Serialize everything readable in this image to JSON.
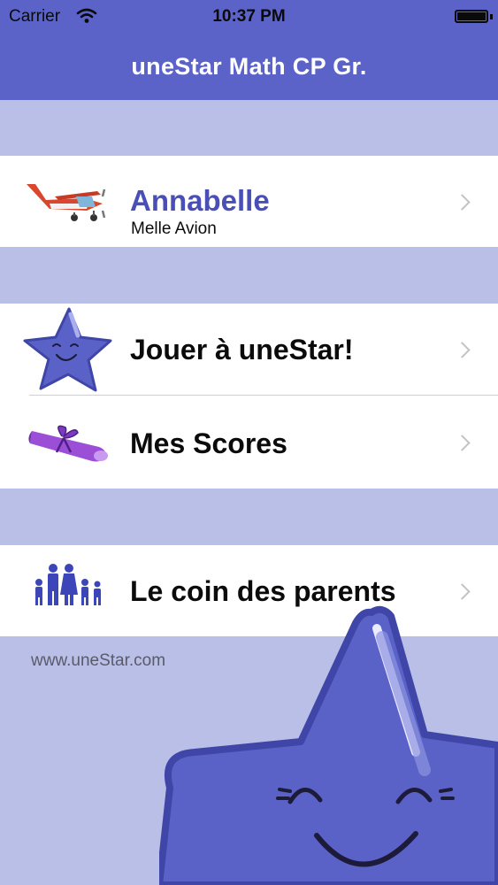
{
  "status_bar": {
    "carrier": "Carrier",
    "time": "10:37 PM"
  },
  "nav": {
    "title": "uneStar Math CP Gr."
  },
  "profile": {
    "name": "Annabelle",
    "subtitle": "Melle Avion"
  },
  "menu": {
    "play": "Jouer à uneStar!",
    "scores": "Mes Scores",
    "parents": "Le coin des parents"
  },
  "footer": {
    "website": "www.uneStar.com"
  },
  "colors": {
    "accent": "#5b63c9",
    "background": "#b9bfe6",
    "name_text": "#4a4fb8",
    "star": "#5a62c8"
  },
  "icons": {
    "profile": "airplane-icon",
    "play": "star-icon",
    "scores": "diploma-icon",
    "parents": "family-icon"
  }
}
